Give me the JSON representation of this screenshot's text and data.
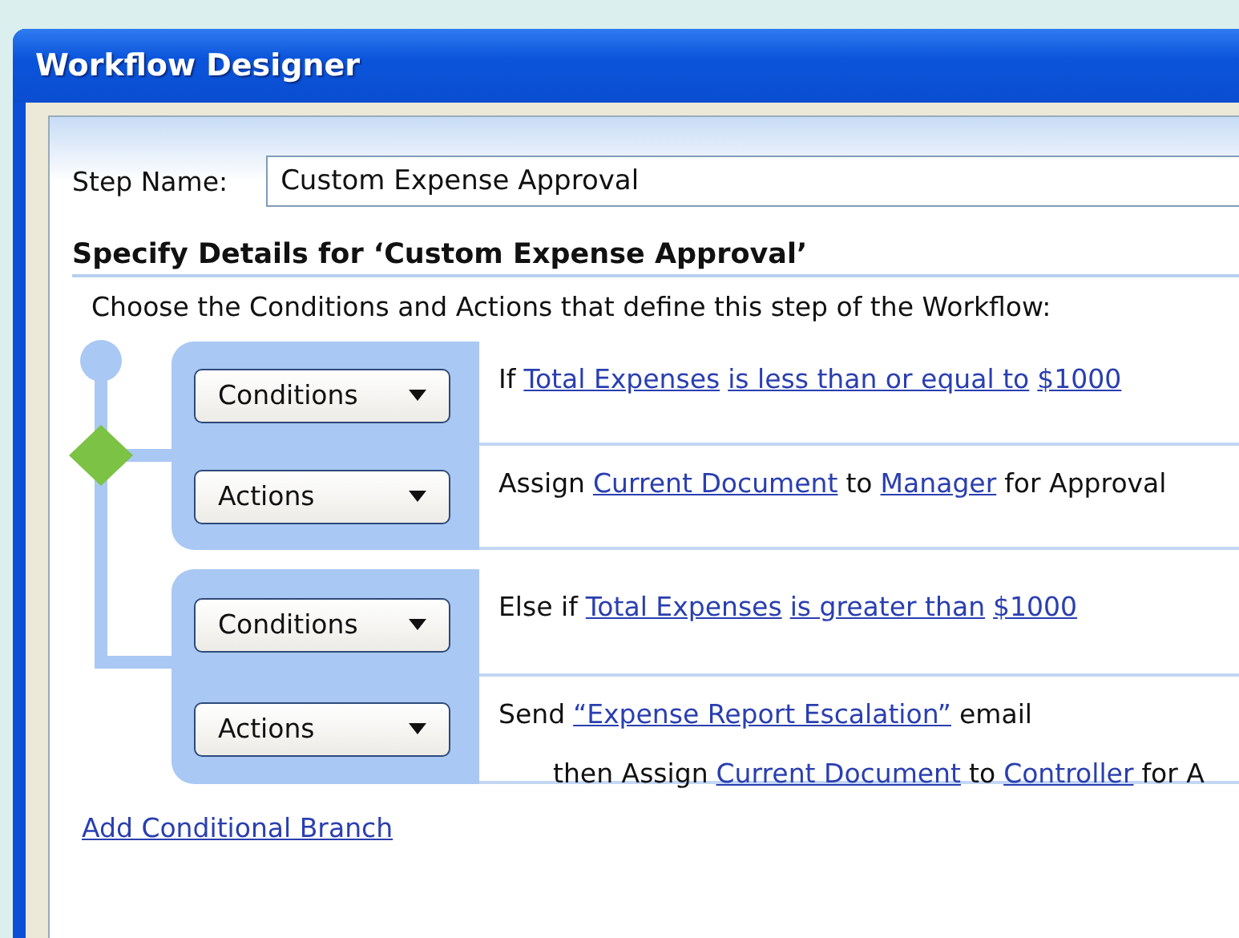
{
  "window": {
    "title": "Workflow Designer"
  },
  "step_name": {
    "label": "Step Name:",
    "value": "Custom Expense Approval"
  },
  "heading": "Specify Details for ‘Custom Expense Approval’",
  "instruction": "Choose the Conditions and Actions that define this step of the Workflow:",
  "branches": [
    {
      "sections": [
        {
          "button": "Conditions",
          "lines": [
            {
              "continued": false,
              "parts": [
                {
                  "text": "If",
                  "link": false
                },
                {
                  "text": "Total Expenses",
                  "link": true
                },
                {
                  "text": "is less than or equal to",
                  "link": true
                },
                {
                  "text": "$1000",
                  "link": true
                }
              ]
            }
          ]
        },
        {
          "button": "Actions",
          "lines": [
            {
              "continued": false,
              "parts": [
                {
                  "text": "Assign",
                  "link": false
                },
                {
                  "text": "Current Document",
                  "link": true
                },
                {
                  "text": "to",
                  "link": false
                },
                {
                  "text": "Manager",
                  "link": true
                },
                {
                  "text": "for Approval",
                  "link": false
                }
              ]
            }
          ]
        }
      ]
    },
    {
      "sections": [
        {
          "button": "Conditions",
          "lines": [
            {
              "continued": false,
              "parts": [
                {
                  "text": "Else if",
                  "link": false
                },
                {
                  "text": "Total Expenses",
                  "link": true
                },
                {
                  "text": "is greater than",
                  "link": true
                },
                {
                  "text": "$1000",
                  "link": true
                }
              ]
            }
          ]
        },
        {
          "button": "Actions",
          "lines": [
            {
              "continued": false,
              "parts": [
                {
                  "text": "Send",
                  "link": false
                },
                {
                  "text": "“Expense Report Escalation”",
                  "link": true
                },
                {
                  "text": "email",
                  "link": false
                }
              ]
            },
            {
              "continued": true,
              "parts": [
                {
                  "text": "then Assign",
                  "link": false
                },
                {
                  "text": "Current Document",
                  "link": true
                },
                {
                  "text": "to",
                  "link": false
                },
                {
                  "text": "Controller",
                  "link": true
                },
                {
                  "text": "for A",
                  "link": false
                }
              ]
            }
          ]
        }
      ]
    }
  ],
  "add_branch_link": "Add Conditional Branch"
}
